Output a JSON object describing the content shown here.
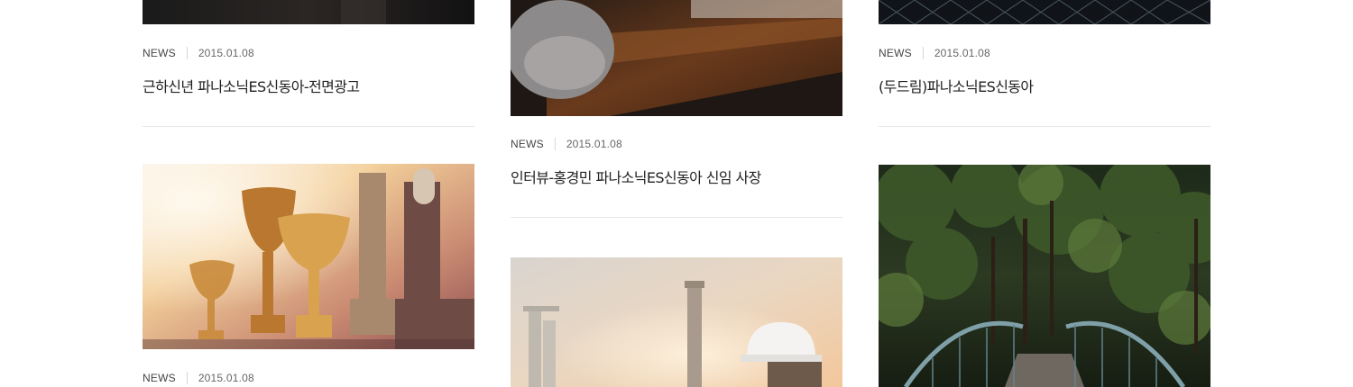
{
  "news_grid": {
    "col1": {
      "card1": {
        "category": "NEWS",
        "date": "2015.01.08",
        "title": "근하신년 파나소닉ES신동아-전면광고",
        "image": "dark-interior-photo"
      },
      "card2": {
        "category": "NEWS",
        "date": "2015.01.08",
        "title": "",
        "image": "trophies-photo"
      }
    },
    "col2": {
      "card1": {
        "category": "NEWS",
        "date": "2015.01.08",
        "title": "인터뷰-홍경민 파나소닉ES신동아 신임 사장",
        "image": "desk-writing-photo"
      },
      "card2": {
        "image": "refinery-engineer-photo"
      }
    },
    "col3": {
      "card1": {
        "category": "NEWS",
        "date": "2015.01.08",
        "title": "(두드림)파나소닉ES신동아",
        "image": "steel-structure-photo"
      },
      "card2": {
        "image": "forest-bridge-photo"
      }
    }
  },
  "colors": {
    "text": "#222222",
    "meta": "#555555",
    "divider": "#e6e6e6"
  }
}
